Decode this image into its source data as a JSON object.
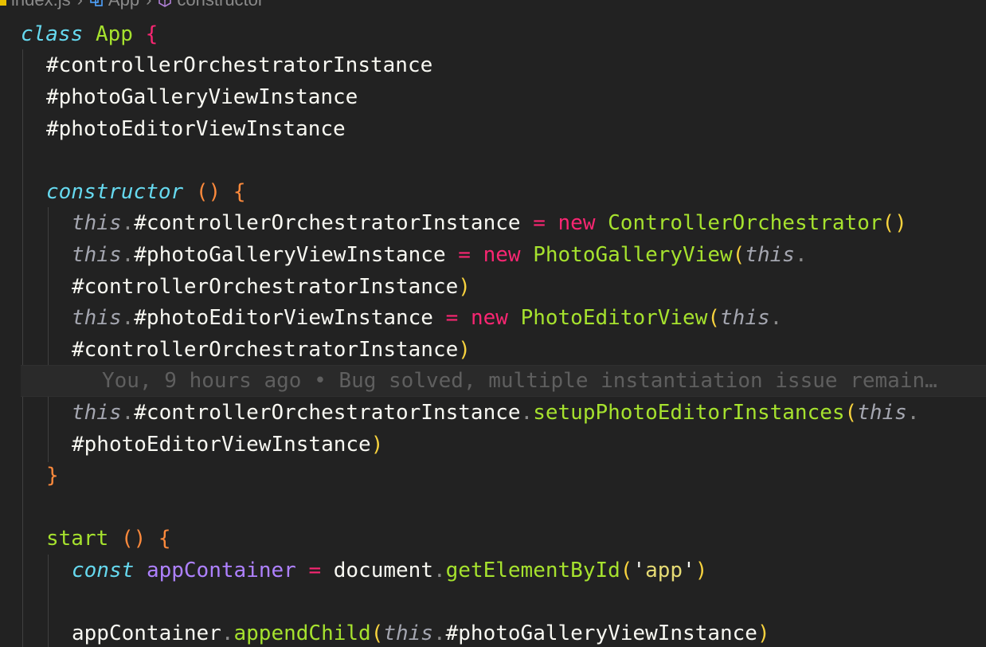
{
  "breadcrumb": {
    "file": "index.js",
    "class_name": "App",
    "method_name": "constructor"
  },
  "code": {
    "class_kw": "class",
    "class_name": "App",
    "open_brace": "{",
    "field1": "#controllerOrchestratorInstance",
    "field2": "#photoGalleryViewInstance",
    "field3": "#photoEditorViewInstance",
    "ctor_kw": "constructor",
    "ctor_parens": "()",
    "ctor_open": "{",
    "this": "this",
    "dot": ".",
    "assign": "=",
    "new_kw": "new",
    "l1_field": "#controllerOrchestratorInstance",
    "l1_class": "ControllerOrchestrator",
    "l1_call": "()",
    "l2_field": "#photoGalleryViewInstance",
    "l2_class": "PhotoGalleryView",
    "open_paren": "(",
    "close_paren": ")",
    "l2_arg": "#controllerOrchestratorInstance",
    "l3_field": "#photoEditorViewInstance",
    "l3_class": "PhotoEditorView",
    "l3_arg": "#controllerOrchestratorInstance",
    "blame": "You, 9 hours ago • Bug solved, multiple instantiation issue remain…",
    "l4_field": "#controllerOrchestratorInstance",
    "l4_method": "setupPhotoEditorInstances",
    "l4_arg": "#photoEditorViewInstance",
    "ctor_close": "}",
    "start_name": "start",
    "start_parens": "()",
    "start_open": "{",
    "const_kw": "const",
    "app_container": "appContainer",
    "document": "document",
    "get_by_id": "getElementById",
    "quote": "'",
    "app_str": "app",
    "append_child": "appendChild",
    "append_arg": "#photoGalleryViewInstance"
  },
  "colors": {
    "background": "#222222",
    "keyword_italic": "#66d9ef",
    "keyword_new": "#f92672",
    "class_name": "#a6e22e",
    "paren": "#f7d23e",
    "brace": "#fd8a3c",
    "variable": "#ae81ff",
    "blame_text": "#5f5f5f"
  },
  "icons": [
    "js-file-icon",
    "class-symbol-icon",
    "method-symbol-icon"
  ]
}
